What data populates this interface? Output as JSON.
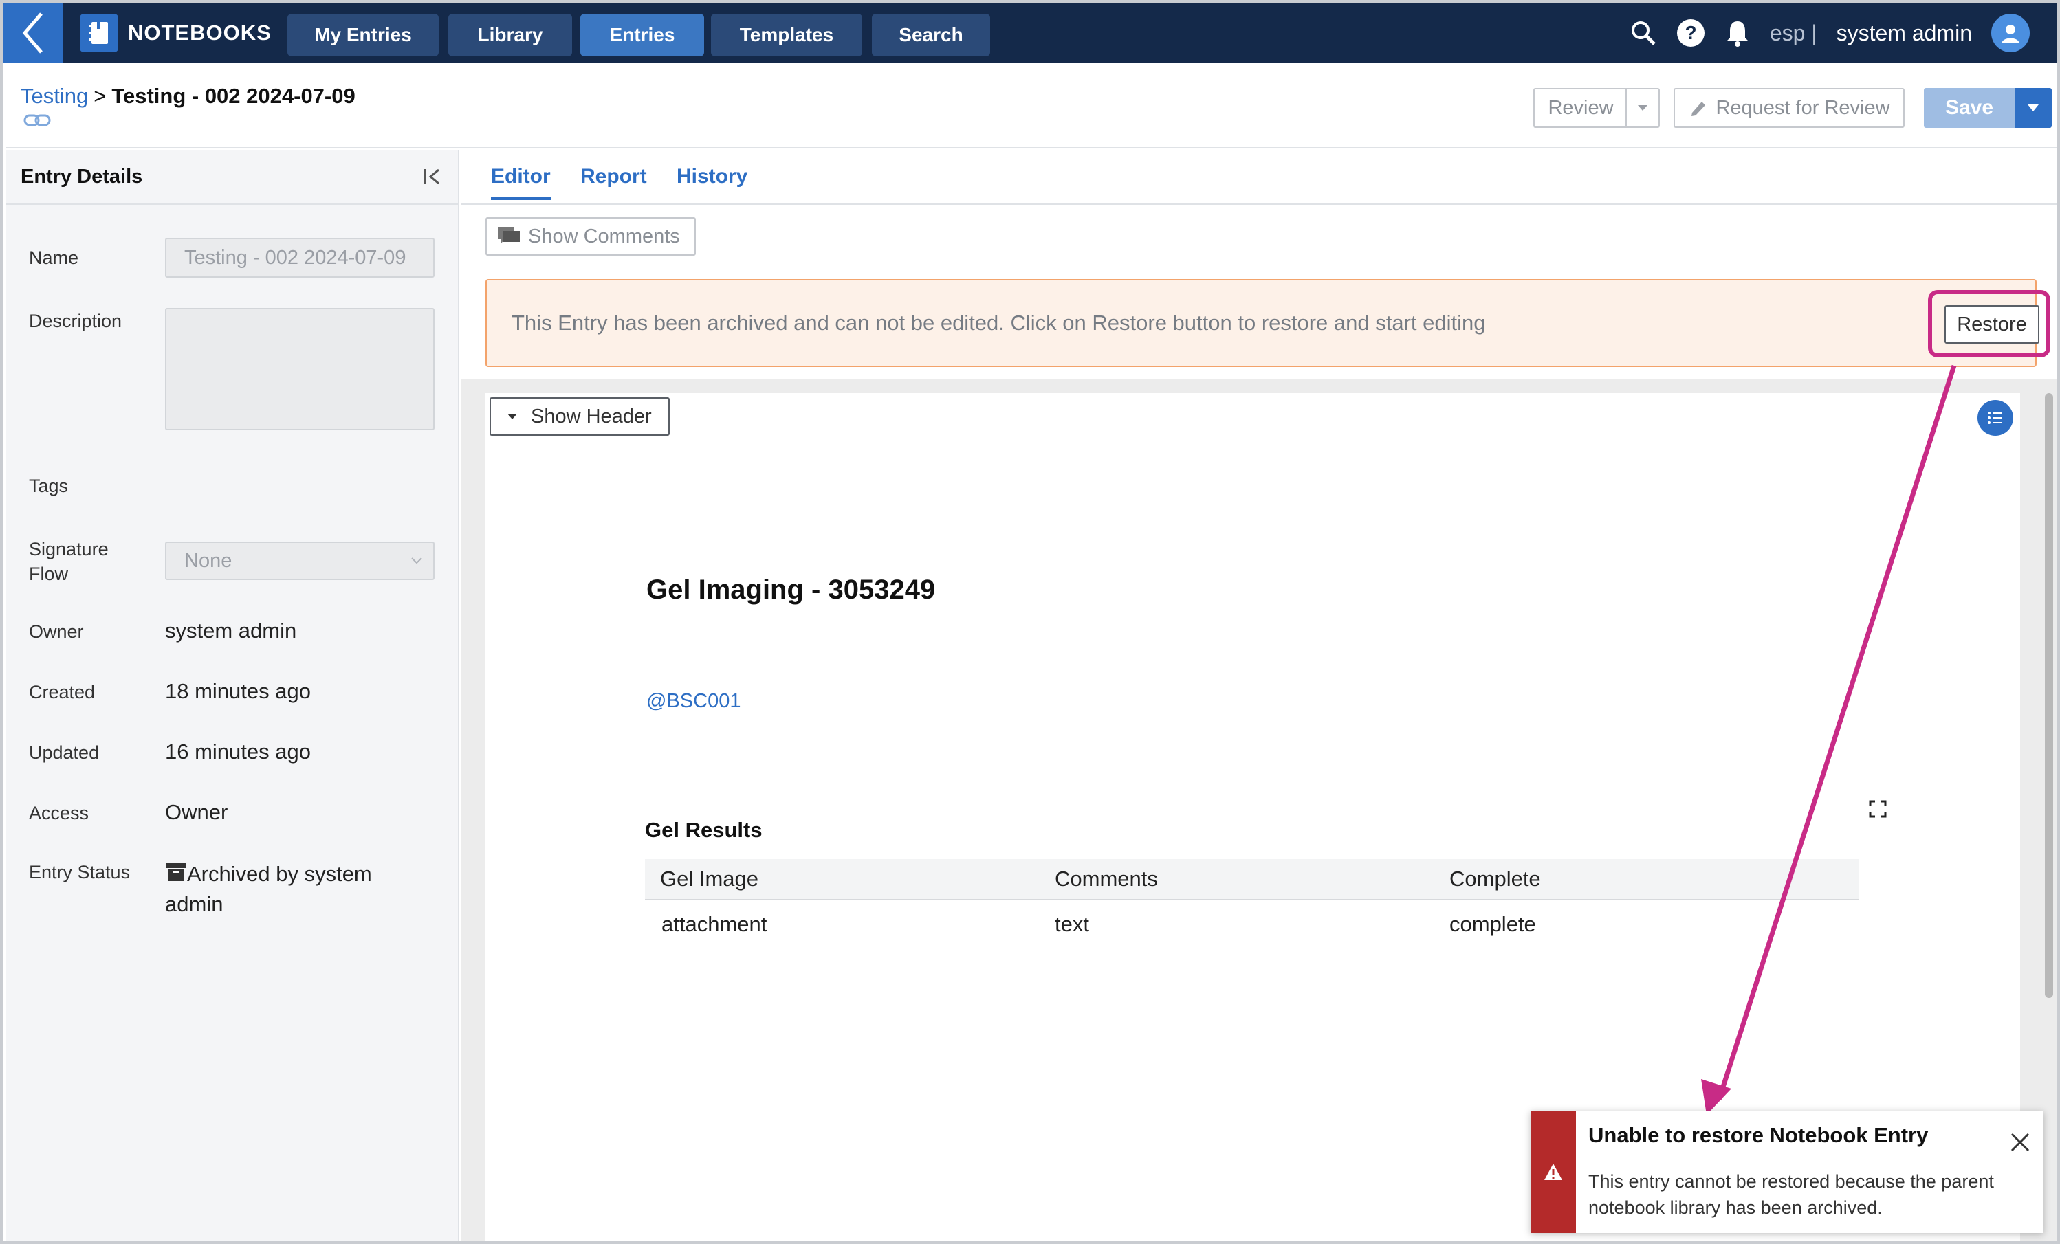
{
  "nav": {
    "brand": "NOTEBOOKS",
    "items": [
      "My Entries",
      "Library",
      "Entries",
      "Templates",
      "Search"
    ],
    "active": "Entries",
    "lang": "esp |",
    "user": "system admin"
  },
  "header": {
    "breadcrumb_parent": "Testing",
    "breadcrumb_sep": ">",
    "breadcrumb_current": "Testing - 002 2024-07-09",
    "review_label": "Review",
    "request_review_label": "Request for Review",
    "save_label": "Save"
  },
  "left": {
    "title": "Entry Details",
    "name_label": "Name",
    "name_value": "Testing - 002 2024-07-09",
    "description_label": "Description",
    "tags_label": "Tags",
    "signature_label_1": "Signature",
    "signature_label_2": "Flow",
    "signature_value": "None",
    "owner_label": "Owner",
    "owner_value": "system admin",
    "created_label": "Created",
    "created_value": "18 minutes ago",
    "updated_label": "Updated",
    "updated_value": "16 minutes ago",
    "access_label": "Access",
    "access_value": "Owner",
    "status_label": "Entry Status",
    "status_value_1": "Archived by system",
    "status_value_2": "admin"
  },
  "tabs": [
    "Editor",
    "Report",
    "History"
  ],
  "main": {
    "show_comments": "Show Comments",
    "alert_text": "This Entry has been archived and can not be edited. Click on Restore button to restore and start editing",
    "restore_label": "Restore",
    "show_header": "Show Header",
    "doc_title": "Gel Imaging - 3053249",
    "mention": "@BSC001",
    "section_title": "Gel Results",
    "table": {
      "headers": [
        "Gel Image",
        "Comments",
        "Complete"
      ],
      "rows": [
        [
          "attachment",
          "text",
          "complete"
        ]
      ]
    }
  },
  "toast": {
    "title": "Unable to restore Notebook Entry",
    "body": "This entry cannot be restored because the parent notebook library has been archived."
  },
  "colors": {
    "nav_bg": "#14294a",
    "accent": "#2d6ec4",
    "highlight": "#c82b86",
    "error": "#b42a2a",
    "alert_bg": "#fdf1e8",
    "alert_border": "#f3a36b"
  }
}
